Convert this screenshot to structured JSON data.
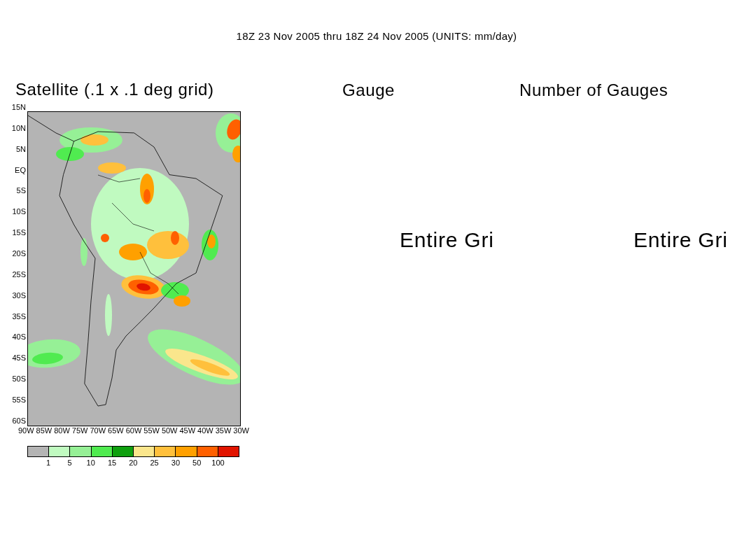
{
  "title": "18Z 23 Nov 2005 thru 18Z 24 Nov 2005 (UNITS: mm/day)",
  "panels": [
    {
      "kind": "map",
      "title": "Satellite (.1 x .1 deg grid)",
      "y_ticks": [
        "15N",
        "10N",
        "5N",
        "EQ",
        "5S",
        "10S",
        "15S",
        "20S",
        "25S",
        "30S",
        "35S",
        "40S",
        "45S",
        "50S",
        "55S",
        "60S"
      ],
      "x_ticks": [
        "90W",
        "85W",
        "80W",
        "75W",
        "70W",
        "65W",
        "60W",
        "55W",
        "50W",
        "45W",
        "40W",
        "35W",
        "30W"
      ],
      "legend": {
        "swatches": [
          {
            "color": "#b4b4b4"
          },
          {
            "color": "#c0fac0"
          },
          {
            "color": "#96f096"
          },
          {
            "color": "#50eb50"
          },
          {
            "color": "#0fa00f"
          },
          {
            "color": "#fae68c"
          },
          {
            "color": "#ffc03c"
          },
          {
            "color": "#ffa000"
          },
          {
            "color": "#ff6000"
          },
          {
            "color": "#e11400"
          }
        ],
        "labels": [
          "1",
          "5",
          "10",
          "15",
          "20",
          "25",
          "30",
          "50",
          "100"
        ]
      }
    },
    {
      "kind": "empty",
      "title": "Gauge",
      "message": "Entire Gri"
    },
    {
      "kind": "empty",
      "title": "Number of Gauges",
      "message": "Entire Gri"
    }
  ]
}
